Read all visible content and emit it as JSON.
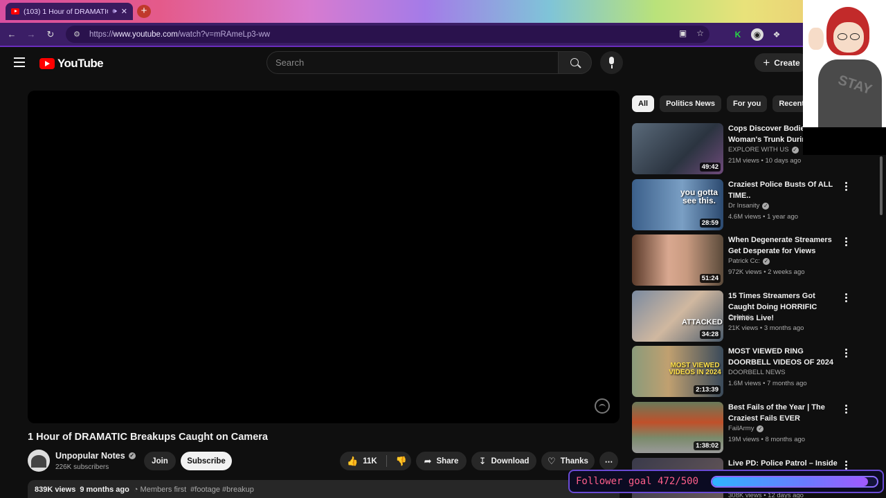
{
  "browser": {
    "tab_title": "(103) 1 Hour of DRAMATIC",
    "url_prefix": "https://",
    "url_host": "www.youtube.com",
    "url_path": "/watch?v=mRAmeLp3-ww",
    "new_tab_symbol": "+"
  },
  "masthead": {
    "logo_text": "YouTube",
    "search_placeholder": "Search",
    "create_label": "Create"
  },
  "video": {
    "title": "1 Hour of DRAMATIC Breakups Caught on Camera",
    "channel": "Unpopular Notes",
    "subscribers": "226K subscribers",
    "join_label": "Join",
    "subscribe_label": "Subscribe",
    "likes": "11K",
    "share_label": "Share",
    "download_label": "Download",
    "thanks_label": "Thanks",
    "views": "839K views",
    "age": "9 months ago",
    "members": "Members first",
    "tags": "#footage #breakup"
  },
  "chips": [
    "All",
    "Politics News",
    "For you",
    "Recently"
  ],
  "recommendations": [
    {
      "title": "Cops Discover Bodies In Woman's Trunk During",
      "channel": "EXPLORE WITH US",
      "meta": "21M views • 10 days ago",
      "duration": "49:42",
      "thumb_text": ""
    },
    {
      "title": "Craziest Police Busts Of ALL TIME..",
      "channel": "Dr Insanity",
      "meta": "4.6M views • 1 year ago",
      "duration": "28:59",
      "thumb_text": "you gotta see this."
    },
    {
      "title": "When Degenerate Streamers Get Desperate for Views",
      "channel": "Patrick Cc:",
      "meta": "972K views • 2 weeks ago",
      "duration": "51:24",
      "thumb_text": ""
    },
    {
      "title": "15 Times Streamers Got Caught Doing HORRIFIC Crimes Live!",
      "channel": "Celebrix",
      "meta": "21K views • 3 months ago",
      "duration": "34:28",
      "thumb_text": "ATTACKED"
    },
    {
      "title": "MOST VIEWED RING DOORBELL VIDEOS OF 2024",
      "channel": "DOORBELL NEWS",
      "meta": "1.6M views • 7 months ago",
      "duration": "2:13:39",
      "thumb_text": "MOST VIEWED VIDEOS IN 2024"
    },
    {
      "title": "Best Fails of the Year | The Craziest Fails EVER",
      "channel": "FailArmy",
      "meta": "19M views • 8 months ago",
      "duration": "1:38:02",
      "thumb_text": ""
    },
    {
      "title": "Live PD: Police Patrol – Inside",
      "channel": "",
      "meta": "308K views • 12 days ago",
      "duration": "",
      "thumb_text": ""
    }
  ],
  "overlay": {
    "follower_goal_text": "Follower goal 472/500",
    "follower_current": 472,
    "follower_target": 500,
    "shirt_text": "STAY"
  },
  "colors": {
    "accent_purple": "#6a2dbd",
    "yt_red": "#ff0000",
    "goal_text": "#ff5f8a"
  }
}
